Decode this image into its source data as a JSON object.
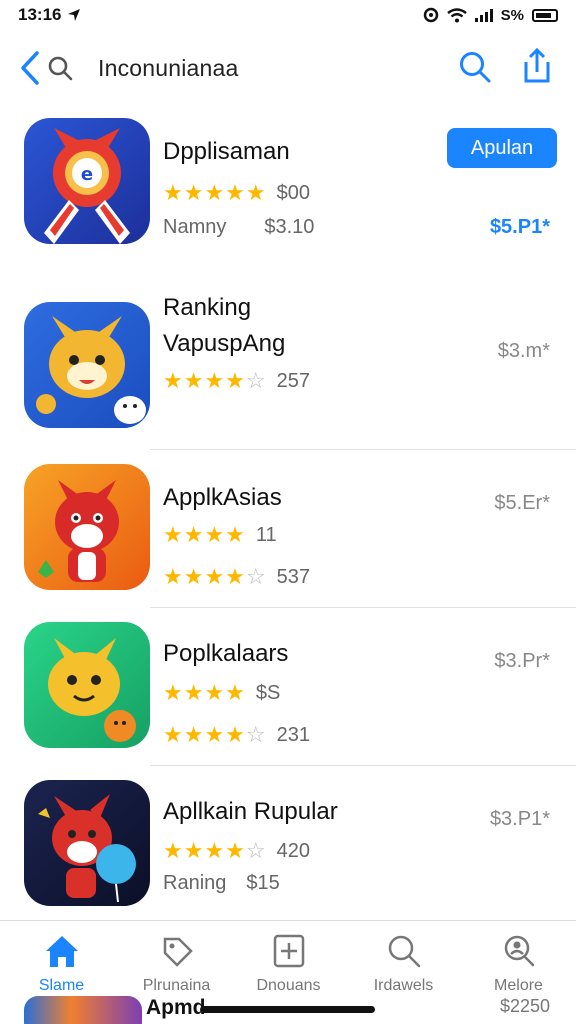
{
  "status": {
    "time": "13:16",
    "right_text": "S%"
  },
  "nav": {
    "title": "Inconunianaa"
  },
  "apps": [
    {
      "name": "Dpplisaman",
      "rating_text": "$00",
      "sub_label": "Namny",
      "sub_value": "$3.10",
      "price": "$5.P1*",
      "button": "Apulan",
      "stars": 5
    },
    {
      "name": "Ranking",
      "name2": "VapuspAng",
      "rating_text": "257",
      "price": "$3.m*",
      "stars": 4
    },
    {
      "name": "ApplkAsias",
      "rating_text": "11",
      "rating2_text": "537",
      "price": "$5.Er*",
      "stars": 4
    },
    {
      "name": "Poplkalaars",
      "rating_text": "$S",
      "rating2_text": "231",
      "price": "$3.Pr*",
      "stars": 4
    },
    {
      "name": "Apllkain Rupular",
      "rating_text": "420",
      "sub_label": "Raning",
      "sub_value": "$15",
      "price": "$3.P1*",
      "stars": 4
    }
  ],
  "tabs": [
    {
      "label": "Slame",
      "icon": "home-icon"
    },
    {
      "label": "Plrunaina",
      "icon": "tag-icon"
    },
    {
      "label": "Dnouans",
      "icon": "plus-box-icon"
    },
    {
      "label": "Irdawels",
      "icon": "search-icon"
    },
    {
      "label": "Melore",
      "icon": "profile-search-icon"
    }
  ],
  "peek": {
    "text": "Apmd",
    "price": "$2250"
  },
  "colors": {
    "accent": "#1b84ff",
    "star": "#ffb800"
  }
}
